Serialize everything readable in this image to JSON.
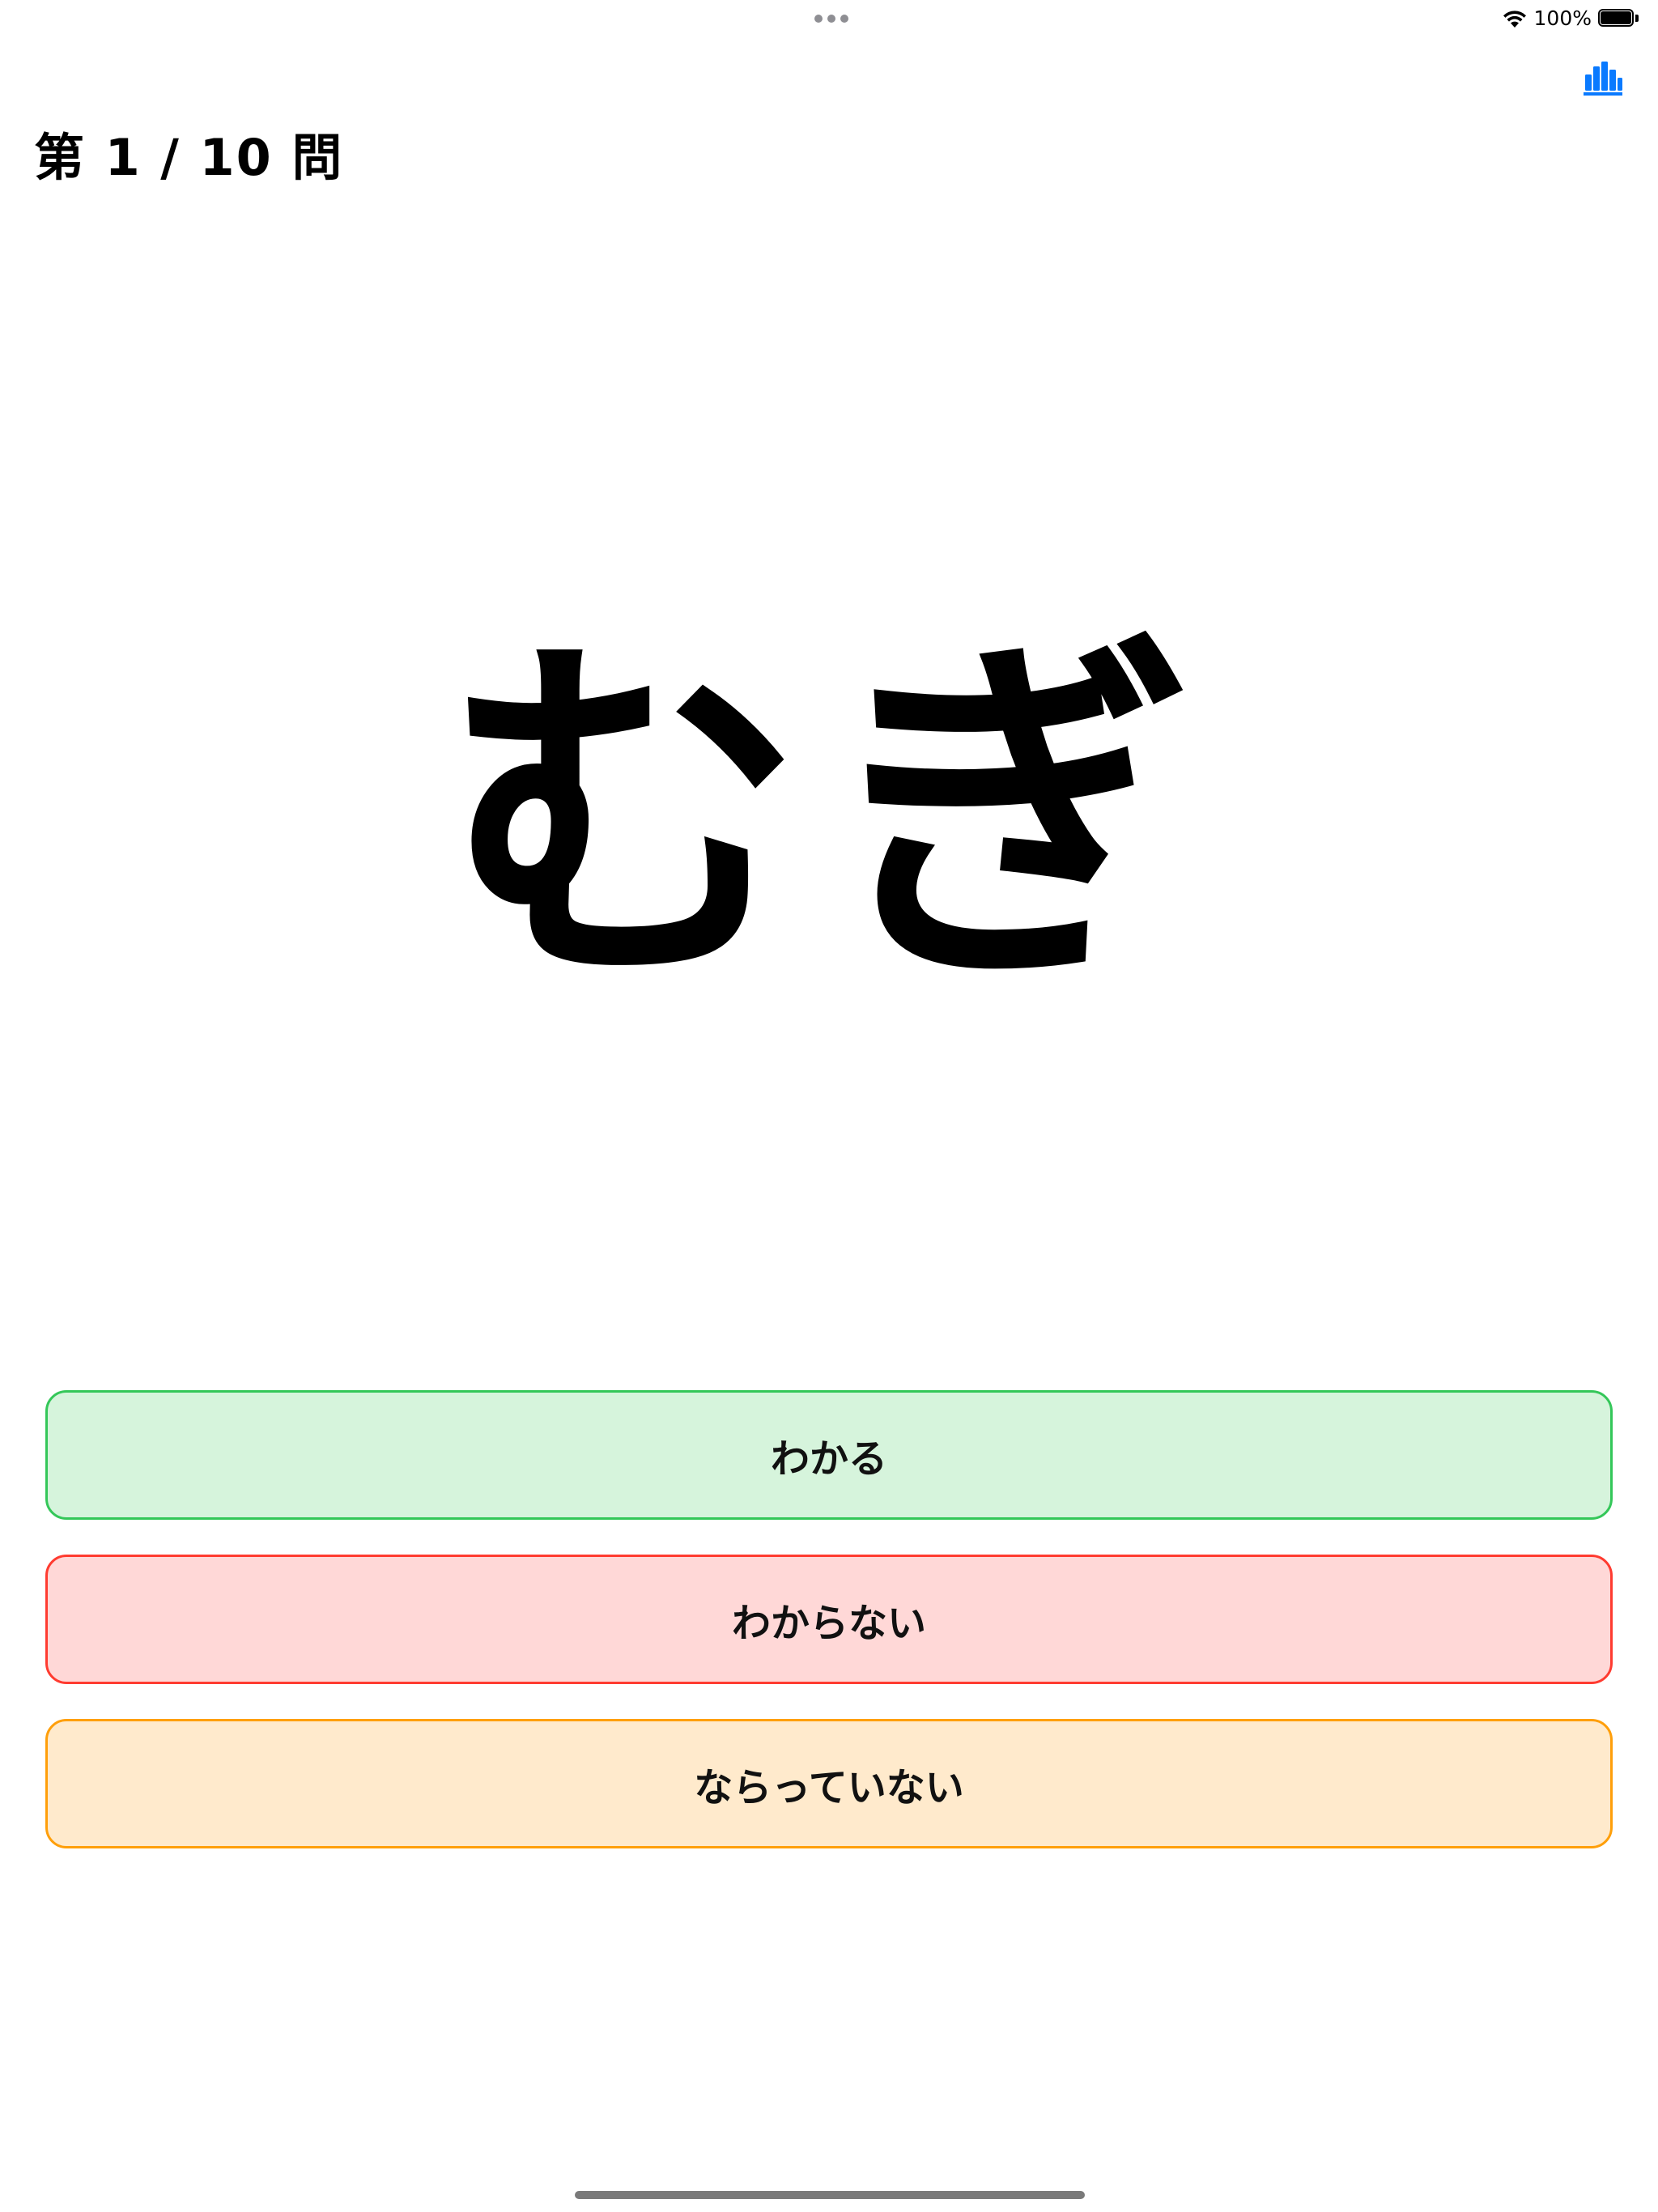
{
  "status_bar": {
    "battery_text": "100%",
    "battery_level_percent": 100
  },
  "header": {
    "question_counter": "第 1 / 10 問",
    "stats_icon": "chart-bar-icon",
    "accent_color": "#0a7aff"
  },
  "quiz": {
    "word": "むぎ"
  },
  "answers": {
    "know_label": "わかる",
    "dont_know_label": "わからない",
    "not_learned_label": "ならっていない",
    "colors": {
      "know_border": "#34c759",
      "know_fill": "#d6f4dc",
      "dont_know_border": "#ff3b30",
      "dont_know_fill": "#ffd8d7",
      "not_learned_border": "#ff9f0a",
      "not_learned_fill": "#ffeacc"
    }
  }
}
